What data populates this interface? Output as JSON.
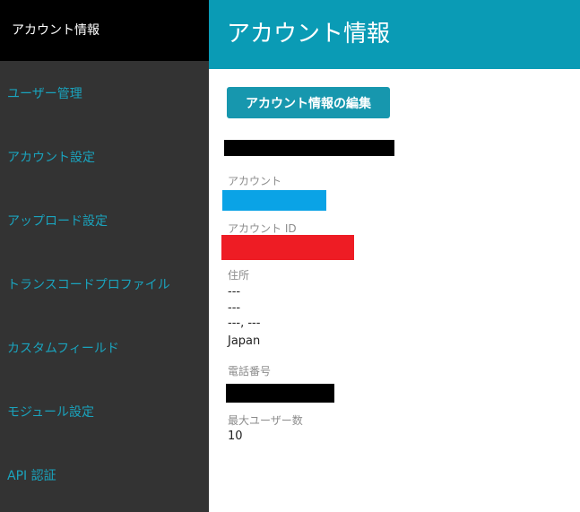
{
  "sidebar": {
    "active_label": "アカウント情報",
    "items": [
      {
        "label": "ユーザー管理"
      },
      {
        "label": "アカウント設定"
      },
      {
        "label": "アップロード設定"
      },
      {
        "label": "トランスコードプロファイル"
      },
      {
        "label": "カスタムフィールド"
      },
      {
        "label": "モジュール設定"
      },
      {
        "label": "API 認証"
      }
    ]
  },
  "header": {
    "title": "アカウント情報"
  },
  "main": {
    "edit_button_label": "アカウント情報の編集",
    "fields": {
      "account_label": "アカウント",
      "account_id_label": "アカウント ID",
      "address_label": "住所",
      "address_lines": [
        "---",
        "---",
        "---, ---",
        "Japan"
      ],
      "phone_label": "電話番号",
      "max_users_label": "最大ユーザー数",
      "max_users_value": "10"
    }
  },
  "colors": {
    "accent": "#0a9bb5",
    "sidebar_bg": "#333333",
    "sidebar_active_bg": "#000000",
    "link": "#1aa3bd",
    "redact_black": "#000000",
    "redact_blue": "#0aa3e6",
    "redact_red": "#ee1c24"
  }
}
